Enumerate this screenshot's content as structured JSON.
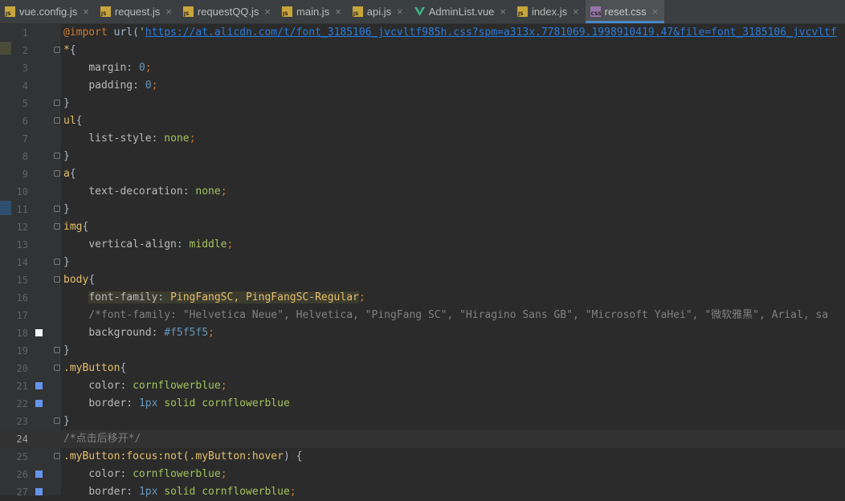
{
  "tabs": [
    {
      "label": "vue.config.js",
      "badge": "JS",
      "icon_color": "#c8a53c",
      "active": false
    },
    {
      "label": "request.js",
      "badge": "JS",
      "icon_color": "#c8a53c",
      "active": false
    },
    {
      "label": "requestQQ.js",
      "badge": "JS",
      "icon_color": "#c8a53c",
      "active": false
    },
    {
      "label": "main.js",
      "badge": "JS",
      "icon_color": "#c8a53c",
      "active": false
    },
    {
      "label": "api.js",
      "badge": "JS",
      "icon_color": "#c8a53c",
      "active": false
    },
    {
      "label": "AdminList.vue",
      "badge": "",
      "icon_color": "#41b883",
      "active": false
    },
    {
      "label": "index.js",
      "badge": "JS",
      "icon_color": "#c8a53c",
      "active": false
    },
    {
      "label": "reset.css",
      "badge": "CSS",
      "icon_color": "#9876aa",
      "active": true
    }
  ],
  "tab_close_glyph": "×",
  "editor": {
    "current_line": 24,
    "line_numbers": [
      "1",
      "2",
      "3",
      "4",
      "5",
      "6",
      "7",
      "8",
      "9",
      "10",
      "11",
      "12",
      "13",
      "14",
      "15",
      "16",
      "17",
      "18",
      "19",
      "20",
      "21",
      "22",
      "23",
      "24",
      "25",
      "26",
      "27"
    ],
    "lines": {
      "l1_at": "@import",
      "l1_fn": " url(",
      "l1_q": "'",
      "l1_url": "https://at.alicdn.com/t/font_3185106_jvcvltf985h.css?spm=a313x.7781069.1998910419.47&file=font_3185106_jvcvltf",
      "l2_sel": "*",
      "l2_brace": "{",
      "l3_prop": "margin",
      "l3_val": "0",
      "l4_prop": "padding",
      "l4_val": "0",
      "l5": "}",
      "l6_sel": "ul",
      "l6_brace": "{",
      "l7_prop": "list-style",
      "l7_val": "none",
      "l8": "}",
      "l9_sel": "a",
      "l9_brace": "{",
      "l10_prop": "text-decoration",
      "l10_val": "none",
      "l11": "}",
      "l12_sel": "img",
      "l12_brace": "{",
      "l13_prop": "vertical-align",
      "l13_val": "middle",
      "l14": "}",
      "l15_sel": "body",
      "l15_brace": "{",
      "l16_prop": "font-family",
      "l16_val": "PingFangSC, PingFangSC-Regular",
      "l17_comment": "/*font-family: \"Helvetica Neue\", Helvetica, \"PingFang SC\", \"Hiragino Sans GB\", \"Microsoft YaHei\", \"微软雅黑\", Arial, sa",
      "l18_prop": "background",
      "l18_val": "#f5f5f5",
      "l19": "}",
      "l20_sel": ".myButton",
      "l20_brace": "{",
      "l21_prop": "color",
      "l21_val": "cornflowerblue",
      "l22_prop": "border",
      "l22_num": "1px",
      "l22_val": " solid cornflowerblue",
      "l23": "}",
      "l24_comment": "/*点击后移开*/",
      "l25_sel": ".myButton",
      "l25_pseudo": ":focus:not(",
      "l25_sel2": ".myButton",
      "l25_pseudo2": ":hover",
      "l25_rest": ") {",
      "l26_prop": "color",
      "l26_val": "cornflowerblue",
      "l27_prop": "border",
      "l27_num": "1px",
      "l27_val": " solid cornflowerblue"
    },
    "colon_sep": ": ",
    "semicolon": ";"
  },
  "colors": {
    "swatch_background": "#f5f5f5",
    "swatch_cornflowerblue": "#6495ed"
  }
}
